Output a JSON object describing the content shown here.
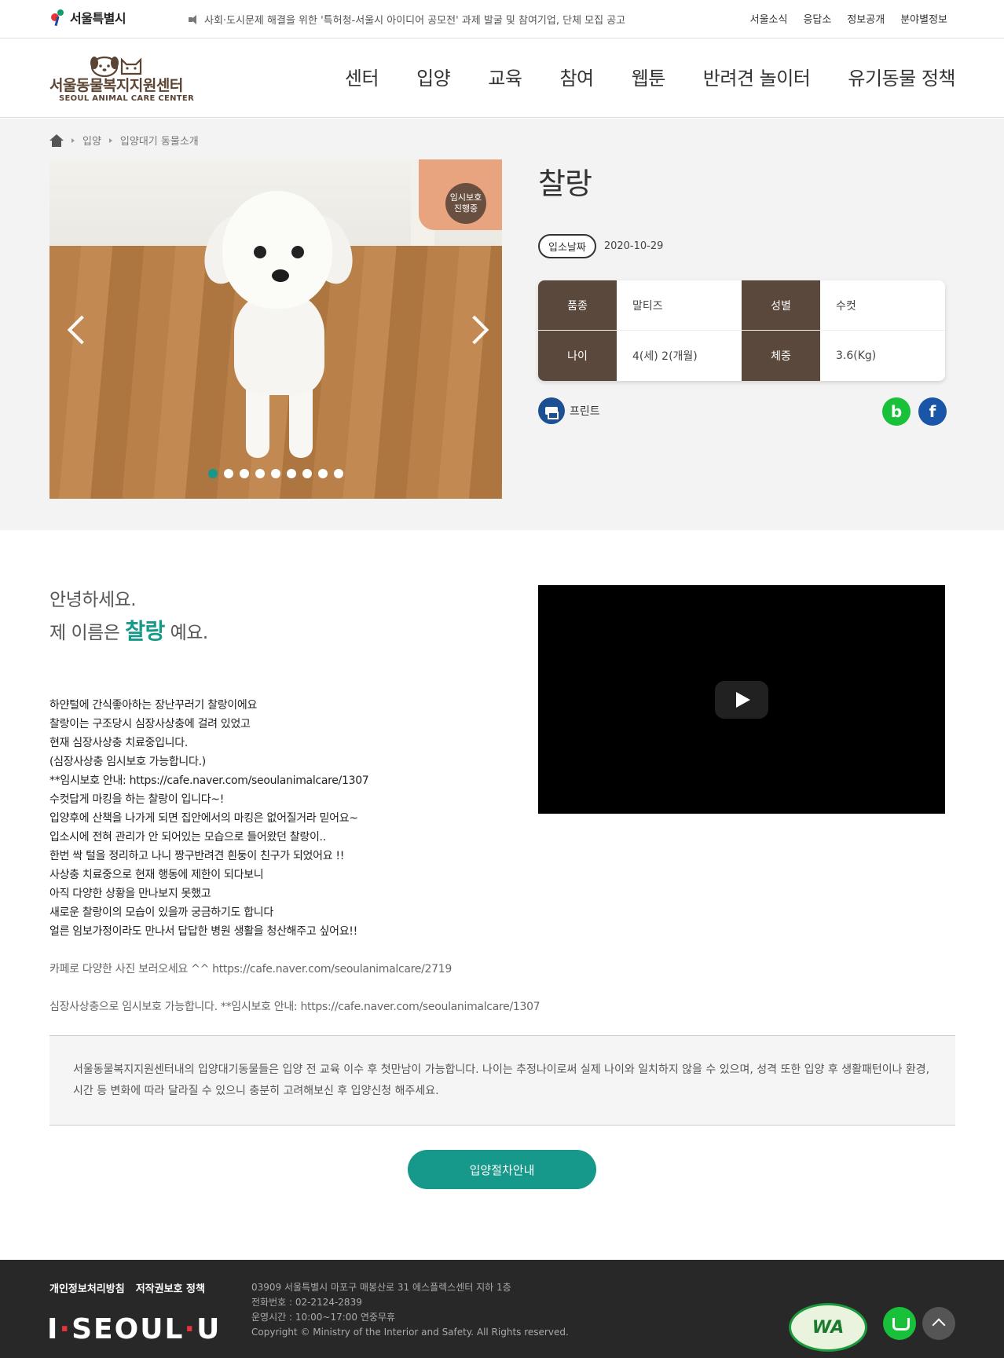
{
  "topbar": {
    "seoul_logo": "서울특별시",
    "notice": "사회·도시문제 해결을 위한 '특허청-서울시 아이디어 공모전' 과제 발굴 및 참여기업, 단체 모집 공고",
    "links": [
      "서울소식",
      "응답소",
      "정보공개",
      "분야별정보"
    ]
  },
  "header": {
    "logo_name": "서울동물복지지원센터",
    "logo_eng": "SEOUL ANIMAL CARE CENTER",
    "nav": [
      "센터",
      "입양",
      "교육",
      "참여",
      "웹툰",
      "반려견 놀이터",
      "유기동물 정책"
    ]
  },
  "breadcrumb": [
    "입양",
    "입양대기 동물소개"
  ],
  "gallery": {
    "badge_line1": "임시보호",
    "badge_line2": "진행중",
    "slide_count": 9,
    "active_slide": 1
  },
  "pet": {
    "name": "찰랑",
    "date_label": "입소날짜",
    "date": "2020-10-29",
    "details": [
      {
        "label": "품종",
        "value": "말티즈",
        "label2": "성별",
        "value2": "수컷"
      },
      {
        "label": "나이",
        "value": "4(세) 2(개월)",
        "label2": "체중",
        "value2": "3.6(Kg)"
      }
    ],
    "print_label": "프린트",
    "share_b": "b",
    "share_f": "f"
  },
  "intro": {
    "greet_line1": "안녕하세요.",
    "greet_prefix": "제 이름은",
    "greet_name": "찰랑",
    "greet_suffix": "예요."
  },
  "story": [
    "하얀털에 간식좋아하는 장난꾸러기 찰랑이에요",
    "찰랑이는 구조당시 심장사상충에 걸려 있었고",
    "현재 심장사상충 치료중입니다.",
    "(심장사상충 임시보호 가능합니다.)",
    "**임시보호 안내: https://cafe.naver.com/seoulanimalcare/1307",
    "수컷답게 마킹을 하는 찰랑이 입니다~!",
    "입양후에 산책을 나가게 되면 집안에서의 마킹은 없어질거라 믿어요~",
    "입소시에 전혀 관리가 안 되어있는 모습으로 들어왔던 찰랑이..",
    "한번 싹 털을 정리하고 나니 짱구반려견 흰둥이 친구가 되었어요 !!",
    "사상충 치료중으로 현재 행동에 제한이 되다보니",
    "아직 다양한 상황을 만나보지 못했고",
    "새로운 찰랑이의 모습이 있을까 궁금하기도 합니다",
    "얼른 임보가정이라도 만나서 답답한 병원 생활을 청산해주고 싶어요!!"
  ],
  "story_extra": {
    "cafe": "카페로 다양한 사진 보러오세요 ^^ https://cafe.naver.com/seoulanimalcare/2719",
    "foster": "심장사상충으로 임시보호 가능합니다. **임시보호 안내: https://cafe.naver.com/seoulanimalcare/1307"
  },
  "notice_box": "서울동물복지지원센터내의 입양대기동물들은 입양 전 교육 이수 후 첫만남이 가능합니다. 나이는 추정나이로써 실제 나이와 일치하지 않을 수 있으며, 성격 또한 입양 후 생활패턴이나 환경, 시간 등 변화에 따라 달라질 수 있으니 충분히 고려해보신 후 입양신청 해주세요.",
  "adopt_button": "입양절차안내",
  "footer": {
    "links": [
      "개인정보처리방침",
      "저작권보호 정책"
    ],
    "brand_i": "I",
    "brand_seoul": "SEOUL",
    "brand_u": "U",
    "address": "03909 서울특별시 마포구 매봉산로 31 에스플렉스센터 지하 1층",
    "phone": "전화번호 : 02-2124-2839",
    "hours": "운영시간 : 10:00~17:00 연중무휴",
    "copyright": "Copyright © Ministry of the Interior and Safety. All Rights reserved.",
    "wa_mark": "WA"
  },
  "colors": {
    "accent": "#16998b",
    "brown": "#5a483c",
    "footer_bg": "#282828"
  }
}
